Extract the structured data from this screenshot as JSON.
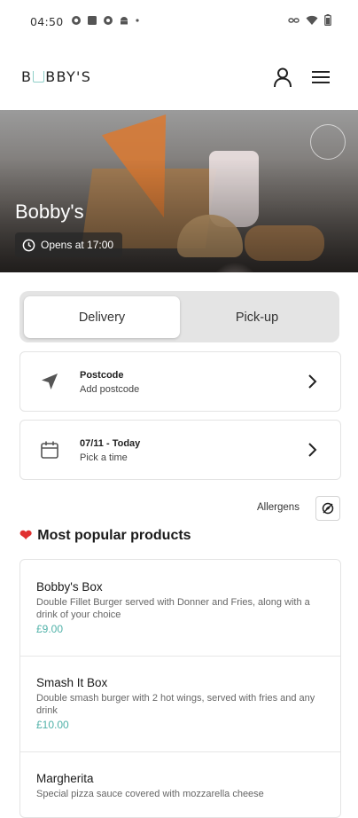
{
  "status_bar": {
    "time": "04:50",
    "icons": [
      "circle-app-icon",
      "square-app-icon",
      "gear-app-icon",
      "android-icon",
      "dot-icon"
    ],
    "right_icons": [
      "link-icon",
      "wifi-icon",
      "battery-icon"
    ]
  },
  "app_bar": {
    "logo": "BOBBY'S",
    "logo_parts": [
      "B",
      "BBY'S"
    ]
  },
  "hero": {
    "restaurant_name": "Bobby's",
    "opens_text": "Opens at 17:00"
  },
  "order_type": {
    "options": [
      "Delivery",
      "Pick-up"
    ],
    "selected": "Delivery"
  },
  "postcode": {
    "title": "Postcode",
    "subtitle": "Add postcode"
  },
  "date_time": {
    "title": "07/11 - Today",
    "subtitle": "Pick a time"
  },
  "allergens_label": "Allergens",
  "popular": {
    "title": "Most popular products",
    "products": [
      {
        "name": "Bobby's Box",
        "description": "Double Fillet Burger served with Donner and Fries, along with a drink of your choice",
        "price": "£9.00"
      },
      {
        "name": "Smash It Box",
        "description": "Double smash burger with 2 hot wings, served with fries and any drink",
        "price": "£10.00"
      },
      {
        "name": "Margherita",
        "description": "Special pizza sauce covered with mozzarella cheese",
        "price": ""
      }
    ]
  },
  "colors": {
    "accent_price": "#4fb1a8",
    "heart": "#e03131",
    "logo_cup": "#8fcfc8"
  }
}
